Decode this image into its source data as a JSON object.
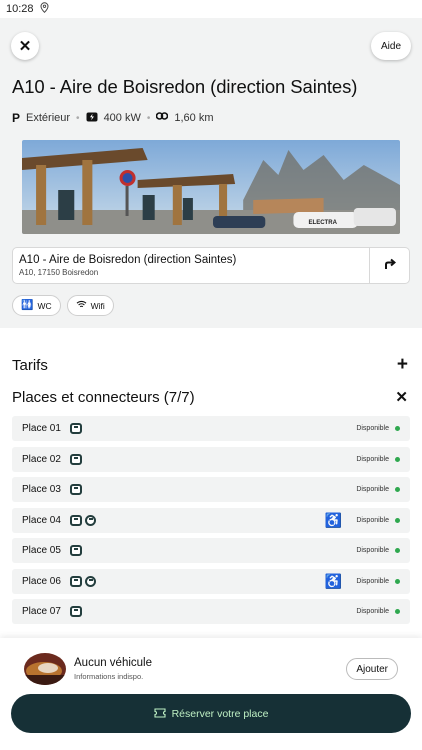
{
  "status_bar": {
    "time": "10:28",
    "location_icon": "location-pin-icon"
  },
  "header": {
    "close_icon": "close-icon",
    "help_label": "Aide"
  },
  "station": {
    "title": "A10 - Aire de Boisredon (direction Saintes)",
    "parking": "Extérieur",
    "power": "400 kW",
    "distance": "1,60 km",
    "address_name": "A10 - Aire de Boisredon (direction Saintes)",
    "address_sub": "A10, 17150 Boisredon",
    "amenities": [
      {
        "icon": "wc-icon",
        "label": "WC"
      },
      {
        "icon": "wifi-icon",
        "label": "Wifi"
      }
    ]
  },
  "sections": {
    "tarifs_label": "Tarifs",
    "places_label": "Places et connecteurs (7/7)"
  },
  "places": [
    {
      "label": "Place 01",
      "connectors": [
        "ccs"
      ],
      "accessible": false,
      "status": "Disponible"
    },
    {
      "label": "Place 02",
      "connectors": [
        "ccs"
      ],
      "accessible": false,
      "status": "Disponible"
    },
    {
      "label": "Place 03",
      "connectors": [
        "ccs"
      ],
      "accessible": false,
      "status": "Disponible"
    },
    {
      "label": "Place 04",
      "connectors": [
        "ccs",
        "type2"
      ],
      "accessible": true,
      "status": "Disponible"
    },
    {
      "label": "Place 05",
      "connectors": [
        "ccs"
      ],
      "accessible": false,
      "status": "Disponible"
    },
    {
      "label": "Place 06",
      "connectors": [
        "ccs",
        "type2"
      ],
      "accessible": true,
      "status": "Disponible"
    },
    {
      "label": "Place 07",
      "connectors": [
        "ccs"
      ],
      "accessible": false,
      "status": "Disponible"
    }
  ],
  "vehicle": {
    "name": "Aucun véhicule",
    "sub": "Informations indispo.",
    "add_label": "Ajouter"
  },
  "cta": {
    "label": "Réserver votre place"
  },
  "colors": {
    "accent_dark": "#163036",
    "accent_text": "#bff0c4",
    "available": "#2fa84f"
  }
}
